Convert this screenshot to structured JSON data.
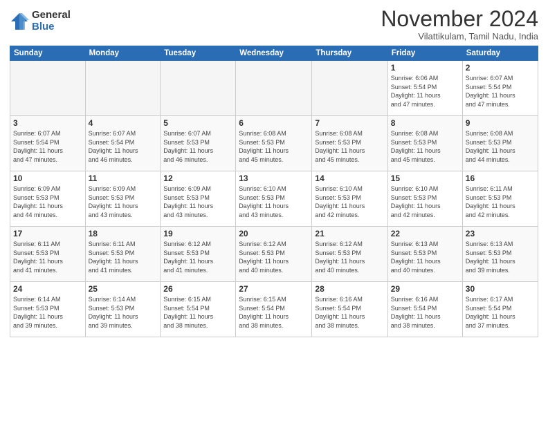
{
  "logo": {
    "general": "General",
    "blue": "Blue"
  },
  "header": {
    "month": "November 2024",
    "location": "Vilattikulam, Tamil Nadu, India"
  },
  "weekdays": [
    "Sunday",
    "Monday",
    "Tuesday",
    "Wednesday",
    "Thursday",
    "Friday",
    "Saturday"
  ],
  "weeks": [
    [
      {
        "day": "",
        "info": ""
      },
      {
        "day": "",
        "info": ""
      },
      {
        "day": "",
        "info": ""
      },
      {
        "day": "",
        "info": ""
      },
      {
        "day": "",
        "info": ""
      },
      {
        "day": "1",
        "info": "Sunrise: 6:06 AM\nSunset: 5:54 PM\nDaylight: 11 hours\nand 47 minutes."
      },
      {
        "day": "2",
        "info": "Sunrise: 6:07 AM\nSunset: 5:54 PM\nDaylight: 11 hours\nand 47 minutes."
      }
    ],
    [
      {
        "day": "3",
        "info": "Sunrise: 6:07 AM\nSunset: 5:54 PM\nDaylight: 11 hours\nand 47 minutes."
      },
      {
        "day": "4",
        "info": "Sunrise: 6:07 AM\nSunset: 5:54 PM\nDaylight: 11 hours\nand 46 minutes."
      },
      {
        "day": "5",
        "info": "Sunrise: 6:07 AM\nSunset: 5:53 PM\nDaylight: 11 hours\nand 46 minutes."
      },
      {
        "day": "6",
        "info": "Sunrise: 6:08 AM\nSunset: 5:53 PM\nDaylight: 11 hours\nand 45 minutes."
      },
      {
        "day": "7",
        "info": "Sunrise: 6:08 AM\nSunset: 5:53 PM\nDaylight: 11 hours\nand 45 minutes."
      },
      {
        "day": "8",
        "info": "Sunrise: 6:08 AM\nSunset: 5:53 PM\nDaylight: 11 hours\nand 45 minutes."
      },
      {
        "day": "9",
        "info": "Sunrise: 6:08 AM\nSunset: 5:53 PM\nDaylight: 11 hours\nand 44 minutes."
      }
    ],
    [
      {
        "day": "10",
        "info": "Sunrise: 6:09 AM\nSunset: 5:53 PM\nDaylight: 11 hours\nand 44 minutes."
      },
      {
        "day": "11",
        "info": "Sunrise: 6:09 AM\nSunset: 5:53 PM\nDaylight: 11 hours\nand 43 minutes."
      },
      {
        "day": "12",
        "info": "Sunrise: 6:09 AM\nSunset: 5:53 PM\nDaylight: 11 hours\nand 43 minutes."
      },
      {
        "day": "13",
        "info": "Sunrise: 6:10 AM\nSunset: 5:53 PM\nDaylight: 11 hours\nand 43 minutes."
      },
      {
        "day": "14",
        "info": "Sunrise: 6:10 AM\nSunset: 5:53 PM\nDaylight: 11 hours\nand 42 minutes."
      },
      {
        "day": "15",
        "info": "Sunrise: 6:10 AM\nSunset: 5:53 PM\nDaylight: 11 hours\nand 42 minutes."
      },
      {
        "day": "16",
        "info": "Sunrise: 6:11 AM\nSunset: 5:53 PM\nDaylight: 11 hours\nand 42 minutes."
      }
    ],
    [
      {
        "day": "17",
        "info": "Sunrise: 6:11 AM\nSunset: 5:53 PM\nDaylight: 11 hours\nand 41 minutes."
      },
      {
        "day": "18",
        "info": "Sunrise: 6:11 AM\nSunset: 5:53 PM\nDaylight: 11 hours\nand 41 minutes."
      },
      {
        "day": "19",
        "info": "Sunrise: 6:12 AM\nSunset: 5:53 PM\nDaylight: 11 hours\nand 41 minutes."
      },
      {
        "day": "20",
        "info": "Sunrise: 6:12 AM\nSunset: 5:53 PM\nDaylight: 11 hours\nand 40 minutes."
      },
      {
        "day": "21",
        "info": "Sunrise: 6:12 AM\nSunset: 5:53 PM\nDaylight: 11 hours\nand 40 minutes."
      },
      {
        "day": "22",
        "info": "Sunrise: 6:13 AM\nSunset: 5:53 PM\nDaylight: 11 hours\nand 40 minutes."
      },
      {
        "day": "23",
        "info": "Sunrise: 6:13 AM\nSunset: 5:53 PM\nDaylight: 11 hours\nand 39 minutes."
      }
    ],
    [
      {
        "day": "24",
        "info": "Sunrise: 6:14 AM\nSunset: 5:53 PM\nDaylight: 11 hours\nand 39 minutes."
      },
      {
        "day": "25",
        "info": "Sunrise: 6:14 AM\nSunset: 5:53 PM\nDaylight: 11 hours\nand 39 minutes."
      },
      {
        "day": "26",
        "info": "Sunrise: 6:15 AM\nSunset: 5:54 PM\nDaylight: 11 hours\nand 38 minutes."
      },
      {
        "day": "27",
        "info": "Sunrise: 6:15 AM\nSunset: 5:54 PM\nDaylight: 11 hours\nand 38 minutes."
      },
      {
        "day": "28",
        "info": "Sunrise: 6:16 AM\nSunset: 5:54 PM\nDaylight: 11 hours\nand 38 minutes."
      },
      {
        "day": "29",
        "info": "Sunrise: 6:16 AM\nSunset: 5:54 PM\nDaylight: 11 hours\nand 38 minutes."
      },
      {
        "day": "30",
        "info": "Sunrise: 6:17 AM\nSunset: 5:54 PM\nDaylight: 11 hours\nand 37 minutes."
      }
    ]
  ]
}
